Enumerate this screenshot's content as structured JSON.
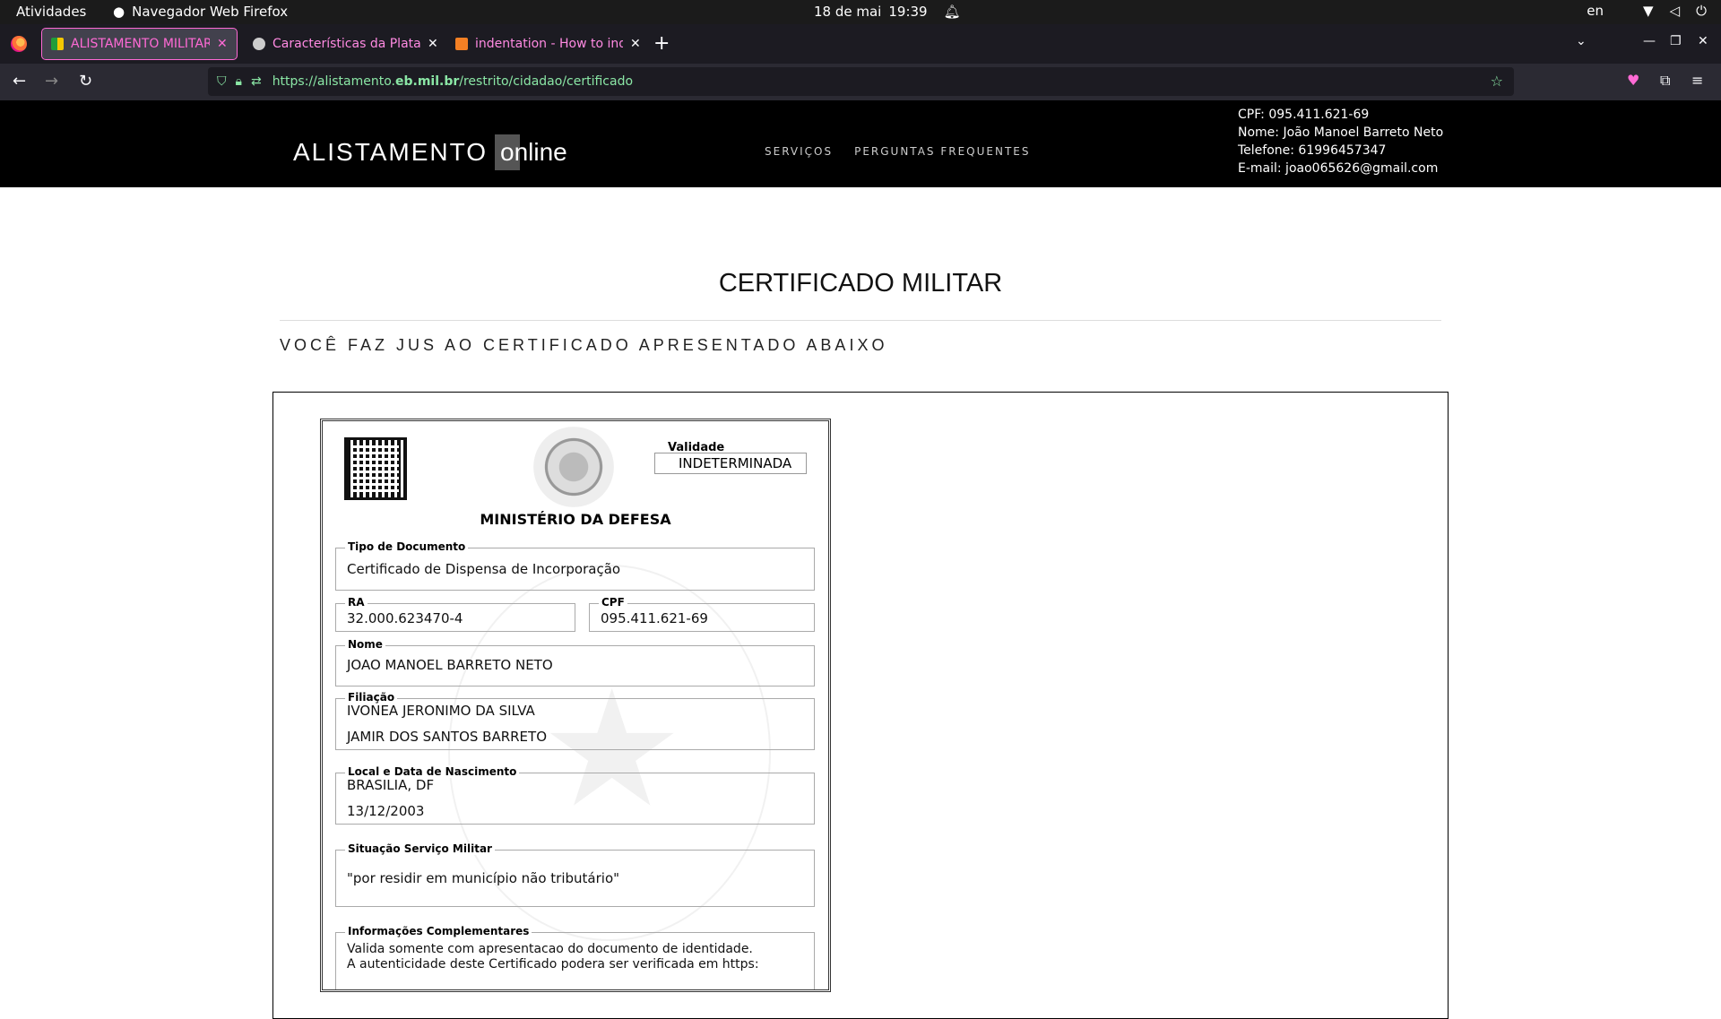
{
  "system_bar": {
    "activities": "Atividades",
    "app_name": "Navegador Web Firefox",
    "date": "18 de mai",
    "time": "19:39",
    "lang": "en"
  },
  "browser": {
    "tabs": [
      {
        "title": "ALISTAMENTO MILITAR O",
        "active": true
      },
      {
        "title": "Características da Plataforma",
        "active": false
      },
      {
        "title": "indentation - How to indent",
        "active": false
      }
    ],
    "url_prefix": "https://alistamento.",
    "url_domain": "eb.mil.br",
    "url_path": "/restrito/cidadao/certificado"
  },
  "site": {
    "logo_main": "ALISTAMENTO",
    "logo_online": "online",
    "nav": [
      "SERVIÇOS",
      "PERGUNTAS FREQUENTES"
    ],
    "user": {
      "cpf": "CPF: 095.411.621-69",
      "nome": "Nome: João Manoel Barreto Neto",
      "telefone": "Telefone: 61996457347",
      "email": "E-mail: joao065626@gmail.com"
    }
  },
  "page": {
    "title": "CERTIFICADO MILITAR",
    "subtitle": "VOCÊ FAZ JUS AO CERTIFICADO APRESENTADO ABAIXO"
  },
  "certificate": {
    "validade_label": "Validade",
    "validade_value": "INDETERMINADA",
    "ministerio": "MINISTÉRIO DA DEFESA",
    "tipo_label": "Tipo de Documento",
    "tipo_value": "Certificado de Dispensa de Incorporação",
    "ra_label": "RA",
    "ra_value": "32.000.623470-4",
    "cpf_label": "CPF",
    "cpf_value": "095.411.621-69",
    "nome_label": "Nome",
    "nome_value": "JOAO MANOEL BARRETO NETO",
    "filiacao_label": "Filiação",
    "filiacao_1": "IVONEA JERONIMO DA SILVA",
    "filiacao_2": "JAMIR DOS SANTOS BARRETO",
    "nasc_label": "Local e Data de Nascimento",
    "nasc_local": "BRASILIA, DF",
    "nasc_data": "13/12/2003",
    "situacao_label": "Situação Serviço Militar",
    "situacao_value": "\"por residir em município não tributário\"",
    "info_label": "Informações Complementares",
    "info_1": "Valida somente com apresentacao do documento de identidade.",
    "info_2": "A autenticidade deste Certificado podera ser verificada em https:"
  }
}
